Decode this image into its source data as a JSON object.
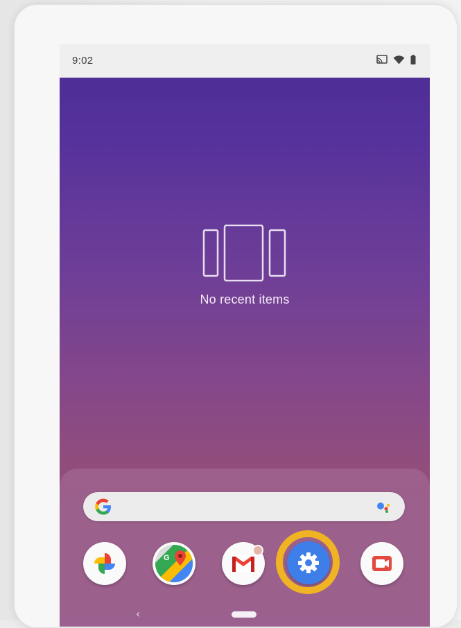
{
  "status_bar": {
    "time": "9:02",
    "icons": [
      "cast-icon",
      "wifi-icon",
      "battery-icon"
    ]
  },
  "recents": {
    "empty_message": "No recent items",
    "illustration_icon": "recent-cards-icon"
  },
  "search": {
    "left_icon": "google-g-icon",
    "right_icon": "assistant-icon"
  },
  "dock": {
    "apps": [
      {
        "name": "photos",
        "icon": "photos-pinwheel-icon"
      },
      {
        "name": "maps",
        "icon": "maps-pin-icon"
      },
      {
        "name": "gmail",
        "icon": "gmail-envelope-icon",
        "notification_dot": true
      },
      {
        "name": "settings",
        "icon": "gear-icon",
        "highlighted": true
      },
      {
        "name": "duo",
        "icon": "video-camera-icon"
      }
    ]
  },
  "navigation": {
    "back_icon": "chevron-left-icon",
    "home_icon": "home-pill-icon"
  },
  "colors": {
    "highlight_ring": "#f0b324",
    "settings_blue": "#3e7ee8",
    "wallpaper_top": "#4b2c93",
    "wallpaper_bottom": "#914d7c"
  }
}
